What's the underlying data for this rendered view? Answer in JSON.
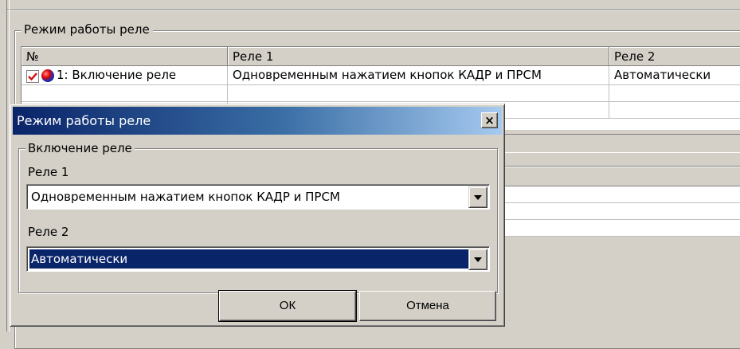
{
  "background": {
    "group_title": "Режим работы реле",
    "table": {
      "columns": [
        "№",
        "Реле 1",
        "Реле 2"
      ],
      "rows": [
        {
          "num": "1: Включение реле",
          "relay1": "Одновременным нажатием кнопок КАДР и ПРСМ",
          "relay2": "Автоматически",
          "checked": true
        }
      ]
    }
  },
  "dialog": {
    "title": "Режим работы реле",
    "close_label": "×",
    "group_title": "Включение реле",
    "relay1_label": "Реле 1",
    "relay1_value": "Одновременным нажатием кнопок КАДР и ПРСМ",
    "relay2_label": "Реле 2",
    "relay2_value": "Автоматически",
    "ok_label": "ОК",
    "cancel_label": "Отмена"
  },
  "colors": {
    "titlebar_start": "#0a246a",
    "titlebar_end": "#a6caf0",
    "selection": "#0a246a",
    "window_bg": "#d4d0c8"
  }
}
